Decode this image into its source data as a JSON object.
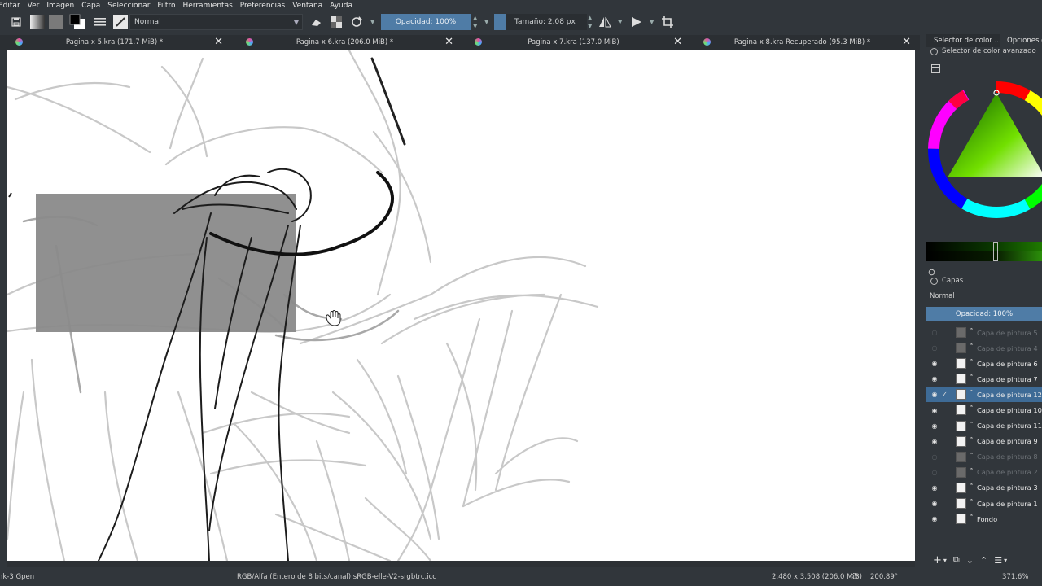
{
  "menu": [
    "Editar",
    "Ver",
    "Imagen",
    "Capa",
    "Seleccionar",
    "Filtro",
    "Herramientas",
    "Preferencias",
    "Ventana",
    "Ayuda"
  ],
  "toolbar": {
    "blend_mode": "Normal",
    "opacity_label": "Opacidad: 100%",
    "size_label": "Tamaño: 2.08 px",
    "icons": [
      "save-icon",
      "gradient-icon",
      "pattern-icon",
      "color-swatch-icon",
      "brush-settings-icon",
      "brush-preset-icon",
      "eraser-icon",
      "alpha-lock-icon",
      "reload-icon",
      "mirror-horizontal-icon",
      "mirror-vertical-icon",
      "crop-icon"
    ]
  },
  "tabs": [
    {
      "label": "Pagina x 5.kra (171.7 MiB) *"
    },
    {
      "label": "Pagina x 6.kra (206.0 MiB) *"
    },
    {
      "label": "Pagina x 7.kra (137.0 MiB)"
    },
    {
      "label": "Pagina x 8.kra Recuperado (95.3 MiB) *"
    }
  ],
  "dock": {
    "tabs": [
      "Selector de color ...",
      "Opciones de"
    ],
    "color_selector_title": "Selector de color avanzado",
    "layers_title": "Capas",
    "layers_blend": "Normal",
    "layers_opacity": "Opacidad:  100%"
  },
  "layers": [
    {
      "name": "Capa de pintura 5",
      "visible": false,
      "selected": false
    },
    {
      "name": "Capa de pintura 4",
      "visible": false,
      "selected": false
    },
    {
      "name": "Capa de pintura 6",
      "visible": true,
      "selected": false
    },
    {
      "name": "Capa de pintura 7",
      "visible": true,
      "selected": false
    },
    {
      "name": "Capa de pintura 12",
      "visible": true,
      "selected": true
    },
    {
      "name": "Capa de pintura 10",
      "visible": true,
      "selected": false
    },
    {
      "name": "Capa de pintura 11",
      "visible": true,
      "selected": false
    },
    {
      "name": "Capa de pintura 9",
      "visible": true,
      "selected": false
    },
    {
      "name": "Capa de pintura 8",
      "visible": false,
      "selected": false
    },
    {
      "name": "Capa de pintura 2",
      "visible": false,
      "selected": false
    },
    {
      "name": "Capa de pintura 3",
      "visible": true,
      "selected": false
    },
    {
      "name": "Capa de pintura 1",
      "visible": true,
      "selected": false
    },
    {
      "name": "Fondo",
      "visible": true,
      "selected": false
    }
  ],
  "status": {
    "brush": "nk-3 Gpen",
    "color_space": "RGB/Alfa (Entero de 8 bits/canal)  sRGB-elle-V2-srgbtrc.icc",
    "image_size": "2,480 x 3,508 (206.0 MiB)",
    "rotation": "200.89°",
    "zoom": "371.6%"
  },
  "colors": {
    "accent": "#4f7ca6",
    "background": "#31363b",
    "selection_box": "#8a8a8a"
  }
}
